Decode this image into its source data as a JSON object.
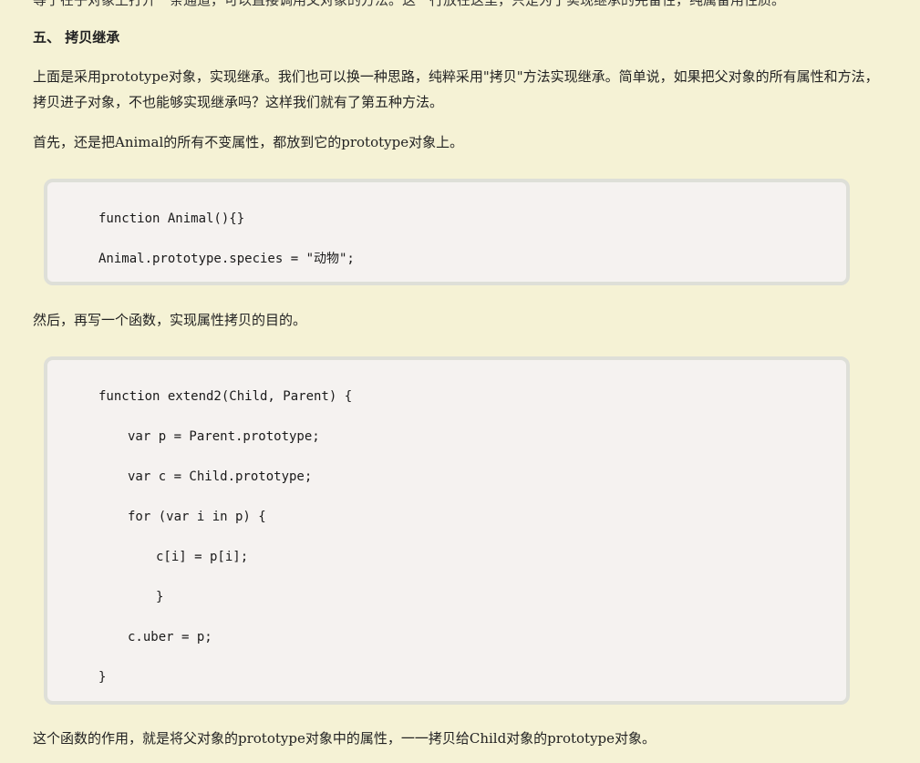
{
  "article": {
    "cut_text": "等于在子对象上打开一条通道，可以直接调用父对象的方法。这一行放在这里，只是为了实现继承的完备性，纯属备用性质。",
    "section_heading": "五、 拷贝继承",
    "para1": "上面是采用prototype对象，实现继承。我们也可以换一种思路，纯粹采用\"拷贝\"方法实现继承。简单说，如果把父对象的所有属性和方法，拷贝进子对象，不也能够实现继承吗？这样我们就有了第五种方法。",
    "para2": "首先，还是把Animal的所有不变属性，都放到它的prototype对象上。",
    "code1": [
      "function Animal(){}",
      "Animal.prototype.species = \"动物\";"
    ],
    "para3": "然后，再写一个函数，实现属性拷贝的目的。",
    "code2": [
      "function extend2(Child, Parent) {",
      "var p = Parent.prototype;",
      "var c = Child.prototype;",
      "for (var i in p) {",
      "c[i] = p[i];",
      "}",
      "c.uber = p;",
      "}"
    ],
    "para4": "这个函数的作用，就是将父对象的prototype对象中的属性，一一拷贝给Child对象的prototype对象。"
  }
}
